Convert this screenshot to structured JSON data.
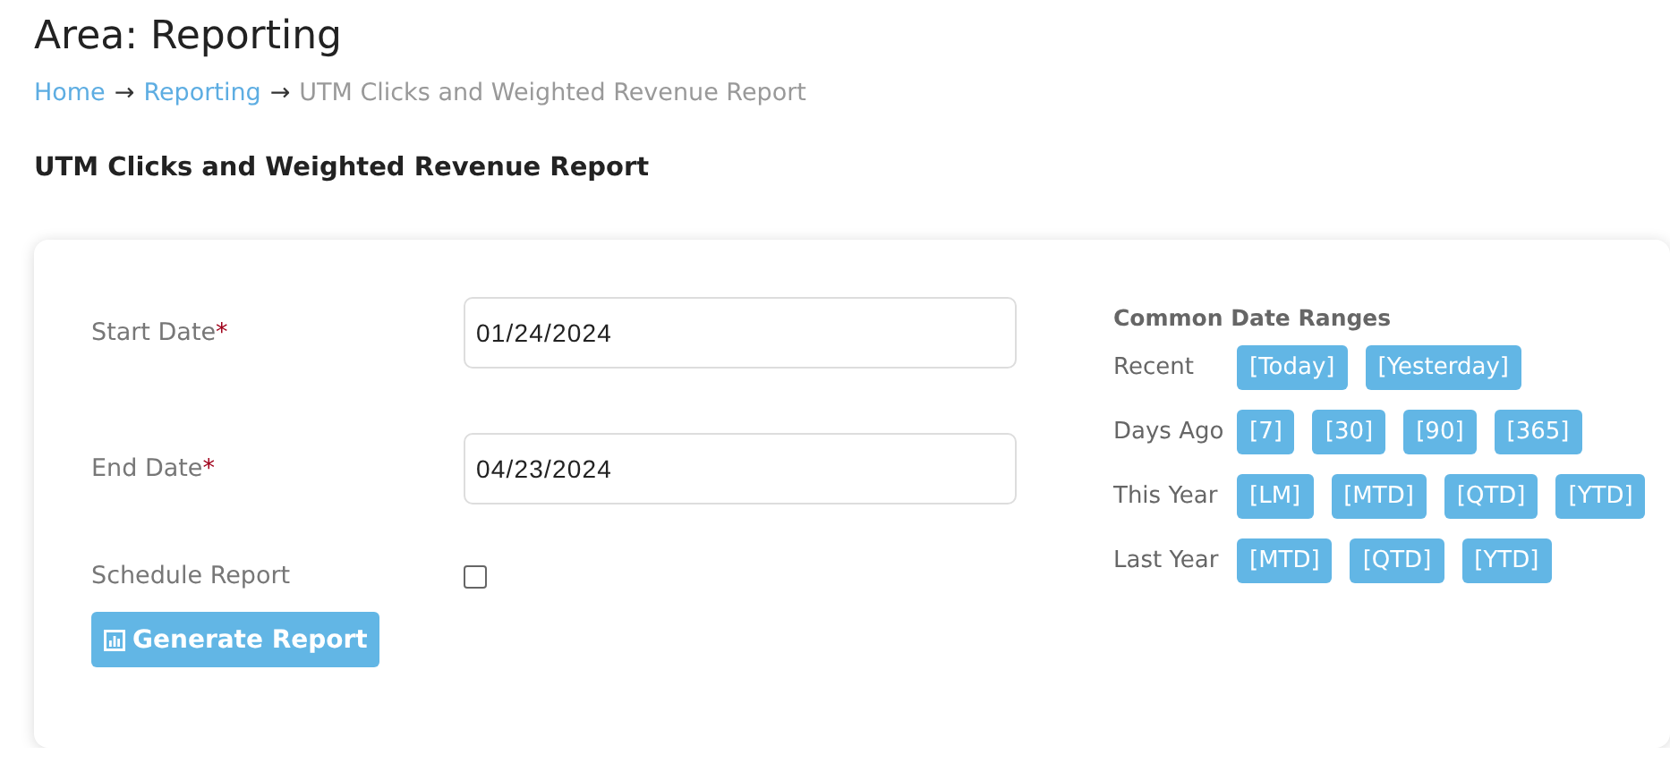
{
  "page": {
    "title": "Area: Reporting"
  },
  "breadcrumb": [
    {
      "kind": "link",
      "label": "Home"
    },
    {
      "kind": "separator",
      "label": "→"
    },
    {
      "kind": "link",
      "label": "Reporting"
    },
    {
      "kind": "separator",
      "label": "→"
    },
    {
      "kind": "current",
      "label": "UTM Clicks and Weighted Revenue Report"
    }
  ],
  "report_title": "UTM Clicks and Weighted Revenue Report",
  "form": {
    "fields": [
      {
        "kind": "date",
        "label": "Start Date",
        "required_mark": "*",
        "value": "01/24/2024"
      },
      {
        "kind": "date",
        "label": "End Date",
        "required_mark": "*",
        "value": "04/23/2024"
      },
      {
        "kind": "checkbox",
        "label": "Schedule Report",
        "checked": false
      }
    ],
    "submit": "Generate Report"
  },
  "date_ranges": {
    "title": "Common Date Ranges",
    "groups": [
      {
        "label": "Recent",
        "buttons": [
          "[Today]",
          "[Yesterday]"
        ]
      },
      {
        "label": "Days Ago",
        "buttons": [
          "[7]",
          "[30]",
          "[90]",
          "[365]"
        ]
      },
      {
        "label": "This Year",
        "buttons": [
          "[LM]",
          "[MTD]",
          "[QTD]",
          "[YTD]"
        ]
      },
      {
        "label": "Last Year",
        "buttons": [
          "[MTD]",
          "[QTD]",
          "[YTD]"
        ]
      }
    ]
  }
}
